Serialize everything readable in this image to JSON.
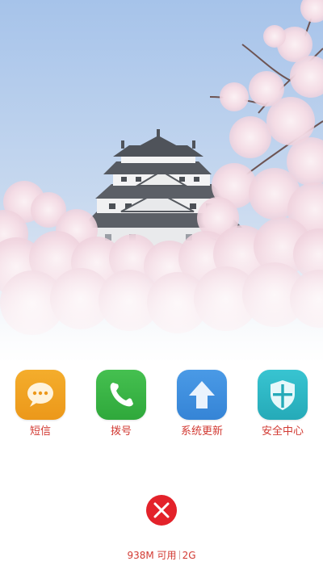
{
  "wallpaper": {
    "sky_top": "#a9c6ea",
    "sky_bottom": "#dfe8f3",
    "blossom_color": "#f7e3ea"
  },
  "apps": [
    {
      "label": "短信",
      "icon": "message-bubble-icon",
      "color": "#f0a322"
    },
    {
      "label": "拨号",
      "icon": "phone-handset-icon",
      "color": "#3bb446"
    },
    {
      "label": "系统更新",
      "icon": "update-arrow-icon",
      "color": "#3f8fdf"
    },
    {
      "label": "安全中心",
      "icon": "shield-icon",
      "color": "#2fb8c6"
    }
  ],
  "clear_button": {
    "icon": "close-x-icon",
    "color": "#e3222a"
  },
  "status": {
    "memory": "938M 可用",
    "network": "2G",
    "text_color": "#d23a33"
  }
}
